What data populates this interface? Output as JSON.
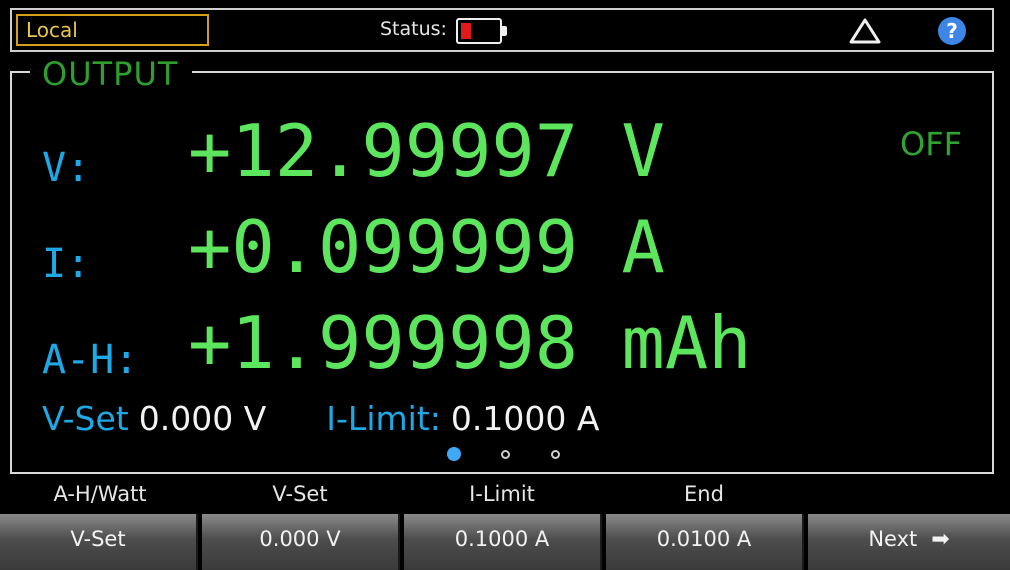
{
  "topbar": {
    "mode": "Local",
    "status_label": "Status:",
    "battery_level": 0.25,
    "battery_color": "#e01a1a",
    "warning_icon": "warning-triangle-icon",
    "help_icon": "help-icon",
    "help_glyph": "?"
  },
  "output": {
    "title": "OUTPUT",
    "state": "OFF",
    "voltage": {
      "label": "V:",
      "value": "+12.99997 V"
    },
    "current": {
      "label": "I:",
      "value": "+0.099999 A"
    },
    "amp_hours": {
      "label": "A-H:",
      "value": "+1.999998 mAh"
    },
    "vset": {
      "label": "V-Set",
      "value": "0.000 V"
    },
    "ilimit": {
      "label": "I-Limit:",
      "value": "0.1000 A"
    },
    "page_index": 1,
    "page_count": 3
  },
  "softkeys": {
    "headers": [
      "A-H/Watt",
      "V-Set",
      "I-Limit",
      "End"
    ],
    "buttons": [
      "V-Set",
      "0.000 V",
      "0.1000 A",
      "0.0100 A",
      "Next"
    ],
    "next_icon": "arrow-right-icon"
  },
  "colors": {
    "reading": "#5de55d",
    "label": "#1ea8e6",
    "title": "#2f9e2f",
    "mode_border": "#d4a017"
  }
}
